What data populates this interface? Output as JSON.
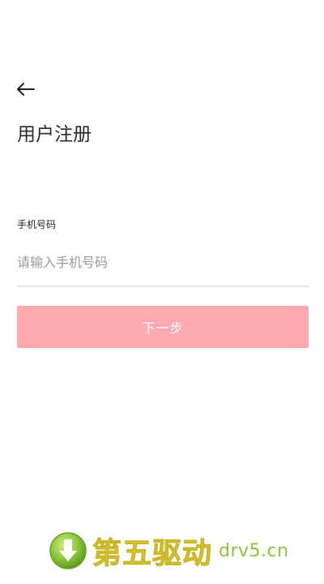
{
  "header": {
    "back_icon": "arrow-left-icon",
    "title": "用户注册"
  },
  "form": {
    "phone_label": "手机号码",
    "phone_placeholder": "请输入手机号码",
    "phone_value": "",
    "next_label": "下一步"
  },
  "watermark": {
    "brand": "第五驱动",
    "domain": "drv5.cn",
    "icon": "download-arrow-icon"
  },
  "colors": {
    "button_bg": "#ffaaae",
    "button_text": "#ffffff",
    "placeholder": "#9a9a9a",
    "underline": "#e3e3e3"
  }
}
